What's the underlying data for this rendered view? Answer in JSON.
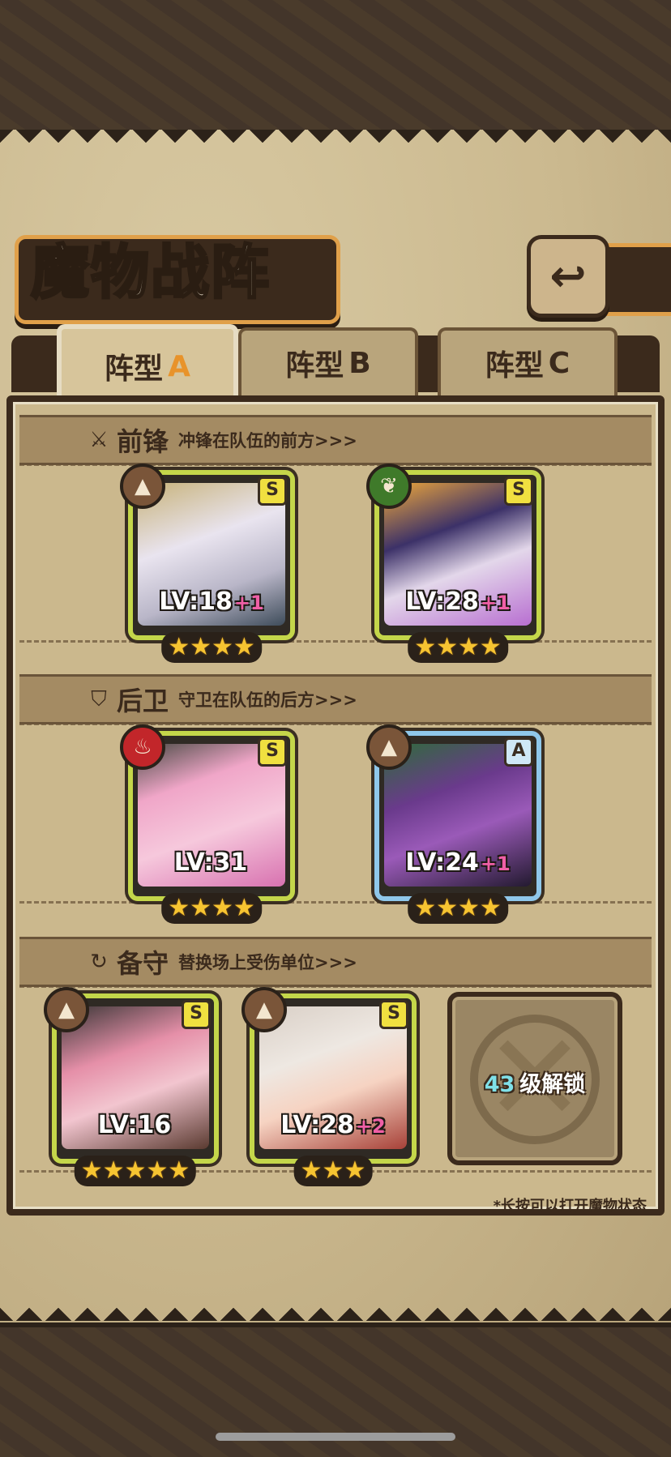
{
  "title": "魔物战阵",
  "back_icon": "back-arrow-icon",
  "tabs": [
    {
      "label": "阵型",
      "suffix": "A",
      "active": true
    },
    {
      "label": "阵型",
      "suffix": "B",
      "active": false
    },
    {
      "label": "阵型",
      "suffix": "C",
      "active": false
    }
  ],
  "sections": {
    "front": {
      "icon": "sword-icon",
      "title": "前锋",
      "desc": "冲锋在队伍的前方>>>"
    },
    "rear": {
      "icon": "shield-icon",
      "title": "后卫",
      "desc": "守卫在队伍的后方>>>"
    },
    "reserve": {
      "icon": "swap-icon",
      "title": "备守",
      "desc": "替换场上受伤单位>>>"
    }
  },
  "monsters": [
    {
      "rank": "S",
      "element": "earth",
      "level": "LV:18",
      "plus": "+1",
      "stars": "★★★★"
    },
    {
      "rank": "S",
      "element": "nature",
      "level": "LV:28",
      "plus": "+1",
      "stars": "★★★★"
    },
    {
      "rank": "S",
      "element": "fire",
      "level": "LV:31",
      "plus": "",
      "stars": "★★★★"
    },
    {
      "rank": "A",
      "element": "earth",
      "level": "LV:24",
      "plus": "+1",
      "stars": "★★★★"
    },
    {
      "rank": "S",
      "element": "earth",
      "level": "LV:16",
      "plus": "",
      "stars": "★★★★★"
    },
    {
      "rank": "S",
      "element": "earth",
      "level": "LV:28",
      "plus": "+2",
      "stars": "★★★"
    }
  ],
  "locked_slot": {
    "level": "43",
    "text": "级解锁"
  },
  "hint": "*长按可以打开魔物状态",
  "colors": {
    "accent": "#e8932a",
    "frame": "#3b2a1c",
    "card_border_s": "#c4d64a",
    "card_border_a": "#8fc7ea"
  }
}
